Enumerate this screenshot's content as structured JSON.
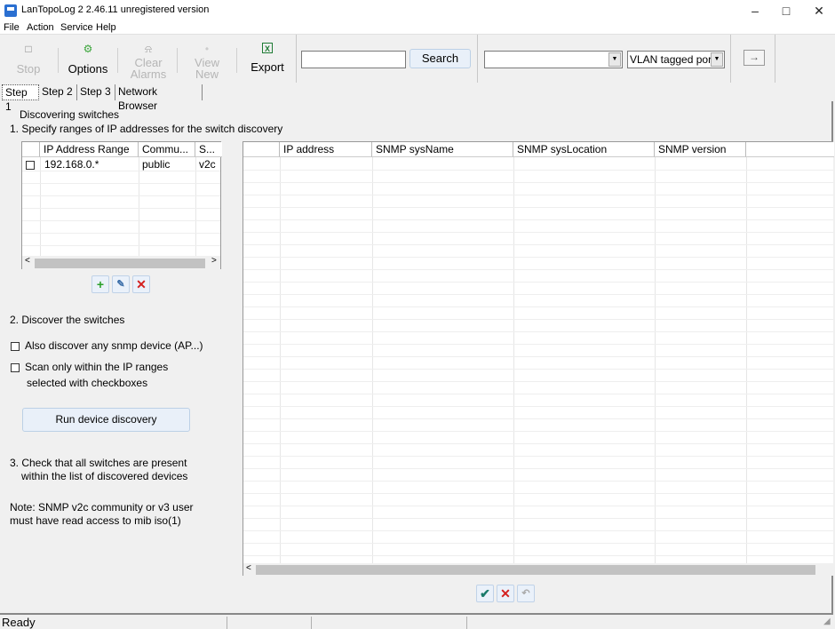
{
  "window": {
    "title": "LanTopoLog 2 2.46.11 unregistered version",
    "controls": {
      "minimize": "–",
      "maximize": "□",
      "close": "✕"
    }
  },
  "menu": [
    "File",
    "Action",
    "Service",
    "Help"
  ],
  "toolbar": {
    "stop": {
      "label": "Stop",
      "icon": "□"
    },
    "options": {
      "label": "Options",
      "icon": "⚙"
    },
    "clear_alarms": {
      "label1": "Clear",
      "label2": "Alarms",
      "icon": "⍾"
    },
    "view_new": {
      "label1": "View",
      "label2": "New",
      "icon": "•"
    },
    "export": {
      "label": "Export",
      "icon": "X"
    },
    "search_value": "",
    "search_button": "Search",
    "combo1_value": "",
    "combo2_value": "VLAN tagged port",
    "arrow_icon": "→"
  },
  "tabs": [
    "Step 1",
    "Step 2",
    "Step 3",
    "Network Browser"
  ],
  "step1": {
    "heading": "Discovering switches",
    "step1_text": "1. Specify ranges of IP addresses for the switch discovery",
    "ip_table": {
      "columns": [
        "IP Address Range",
        "Commu...",
        "S..."
      ],
      "rows": [
        {
          "checked": false,
          "range": "192.168.0.*",
          "community": "public",
          "version": "v2c"
        }
      ]
    },
    "step2_text": "2. Discover the switches",
    "opt_any_snmp": "Also discover any snmp device (AP...)",
    "opt_scan_only_1": "Scan only within the IP ranges",
    "opt_scan_only_2": "selected with checkboxes",
    "run_button": "Run device discovery",
    "step3_line1": "3. Check that all switches are present",
    "step3_line2": "within the list of discovered devices",
    "note_line1": "Note:  SNMP v2c community or v3 user",
    "note_line2": "must have read access to mib iso(1)"
  },
  "device_table": {
    "columns": [
      "",
      "IP address",
      "SNMP sysName",
      "SNMP sysLocation",
      "SNMP version",
      ""
    ],
    "rows": []
  },
  "status": {
    "text": "Ready"
  }
}
